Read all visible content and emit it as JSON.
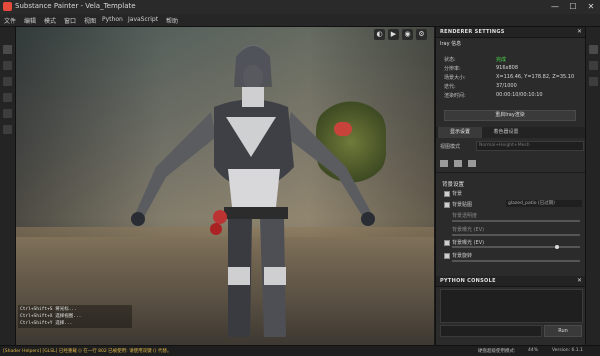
{
  "window": {
    "title": "Substance Painter - Vela_Template",
    "controls": [
      "—",
      "☐",
      "✕"
    ]
  },
  "menu": [
    "文件",
    "编辑",
    "模式",
    "窗口",
    "视图",
    "Python",
    "JavaScript",
    "帮助"
  ],
  "viewport": {
    "log_lines": [
      "Ctrl+Shift+S  将光标...",
      "Ctrl+Shift+X  选择视图...",
      "Ctrl+Shift+Y  选择..."
    ]
  },
  "renderer": {
    "header": "RENDERER SETTINGS",
    "section": "Iray 信息",
    "rows": [
      {
        "key": "状态:",
        "value": "完成",
        "color": "#4cd94c"
      },
      {
        "key": "分辨率:",
        "value": "916x808"
      },
      {
        "key": "场景大小:",
        "value": "X=116.46, Y=178.82, Z=35.10"
      },
      {
        "key": "迭代:",
        "value": "37/1000"
      },
      {
        "key": "渲染时间:",
        "value": "00:00:10/00:10:10"
      }
    ],
    "restart_button": "重启Iray渲染"
  },
  "display": {
    "tabs": [
      "显示设置",
      "着色器设置"
    ],
    "view_mode_label": "视图模式",
    "view_mode_value": "Normal+Height+Mesh",
    "section_title": "背景设置",
    "background_label": "背景",
    "bg_map_label": "背景贴图",
    "bg_map_value": "glazed_patio (已过期)",
    "bg_opacity_label": "背景透明度",
    "bg_blur_label": "背景曝光 (EV)",
    "bg_rotation_label": "背景旋转",
    "exposure_fraction": 0.82
  },
  "console": {
    "header": "PYTHON CONSOLE",
    "run_button": "Run"
  },
  "status": {
    "message": "[Shader Helpers] [GLSL] 已经重载 () 在一行 802 已被使用: 请使用双键 () 代替。",
    "mem_label": "硬盘超级使用模式:",
    "mem_value": "44%",
    "version": "Version: 6.1.1"
  },
  "colors": {
    "accent": "#e64b3c",
    "status_ok": "#4cd94c",
    "warning": "#e0b84a"
  }
}
